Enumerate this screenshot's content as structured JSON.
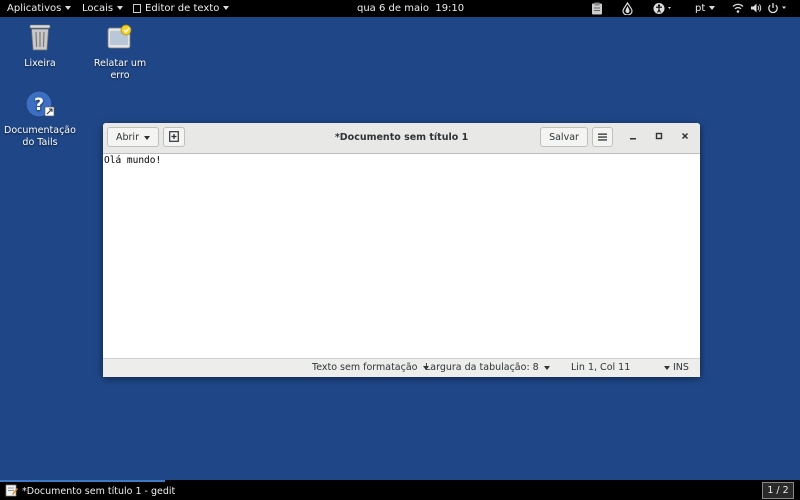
{
  "topbar": {
    "applications": "Aplicativos",
    "places": "Locais",
    "app_menu": "Editor de texto",
    "datetime": "qua 6 de maio  19:10",
    "language": "pt"
  },
  "desktop": {
    "icons": [
      {
        "label": "Lixeira",
        "icon": "trash-icon"
      },
      {
        "label": "Relatar um erro",
        "icon": "bug-report-icon"
      },
      {
        "label_line1": "Documentação",
        "label_line2": "do Tails",
        "icon": "help-icon"
      }
    ]
  },
  "window": {
    "title": "*Documento sem título 1",
    "open_label": "Abrir",
    "save_label": "Salvar",
    "content": "Olá mundo!",
    "status": {
      "format": "Texto sem formatação",
      "tab_width": "Largura da tabulação: 8",
      "position": "Lin 1, Col 11",
      "mode": "INS"
    }
  },
  "taskbar": {
    "task_label": "*Documento sem título 1 - gedit",
    "pager": "1 / 2"
  },
  "colors": {
    "desktop": "#1f4788",
    "bar": "#000000",
    "headerbar": "#e8e8e7",
    "task_accent": "#3c78c4"
  }
}
